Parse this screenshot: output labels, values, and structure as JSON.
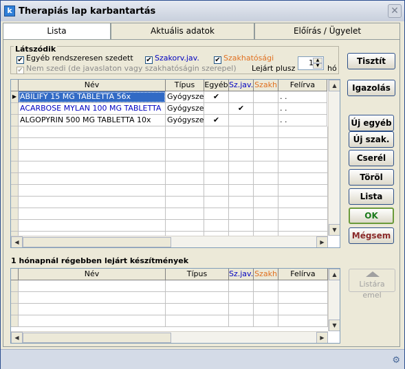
{
  "window": {
    "title": "Therapiás lap karbantartás",
    "app_icon_glyph": "k"
  },
  "tabs": [
    {
      "label": "Lista"
    },
    {
      "label": "Aktuális adatok"
    },
    {
      "label": "Előírás / Ügyelet"
    }
  ],
  "filters": {
    "legend": "Látszódik",
    "opt_regular": "Egyéb rendszeresen szedett",
    "opt_szakorv": "Szakorv.jav.",
    "opt_szakhat": "Szakhatósági",
    "opt_not_taken": "Nem szedi (de javaslaton vagy szakhatóságin szerepel)",
    "expired_label": "Lejárt plusz",
    "expired_value": "1",
    "expired_unit": "hó",
    "colors": {
      "szakorv": "#0000c0",
      "szakhat": "#e07020"
    }
  },
  "main_grid": {
    "headers": {
      "nev": "Név",
      "tipus": "Típus",
      "egyeb": "Egyéb",
      "szjav": "Sz.jav.",
      "szakh": "Szakh",
      "felirva": "Felírva"
    },
    "rows": [
      {
        "nev": "ABILIFY 15 MG TABLETTA 56x",
        "tipus": "Gyógysze",
        "egyeb": "✔",
        "szjav": "",
        "szakh": "",
        "felirva": ". ."
      },
      {
        "nev": "ACARBOSE MYLAN 100 MG TABLETTA",
        "tipus": "Gyógysze",
        "egyeb": "",
        "szjav": "✔",
        "szakh": "",
        "felirva": ". ."
      },
      {
        "nev": "ALGOPYRIN 500 MG TABLETTA 10x",
        "tipus": "Gyógysze",
        "egyeb": "✔",
        "szjav": "",
        "szakh": "",
        "felirva": ". ."
      }
    ]
  },
  "expired_section": {
    "title": "1 hónapnál régebben lejárt készítmények",
    "headers": {
      "nev": "Név",
      "tipus": "Típus",
      "szjav": "Sz.jav.",
      "szakh": "Szakh",
      "felirva": "Felírva"
    }
  },
  "buttons": {
    "tisztit": "Tisztít",
    "igazolas": "Igazolás",
    "uj_egyeb": "Új egyéb",
    "uj_szak": "Új szak.",
    "cserel": "Cserél",
    "torol": "Töröl",
    "lista": "Lista",
    "ok": "OK",
    "megsem": "Mégsem",
    "listara_emel": "Listára emel"
  }
}
